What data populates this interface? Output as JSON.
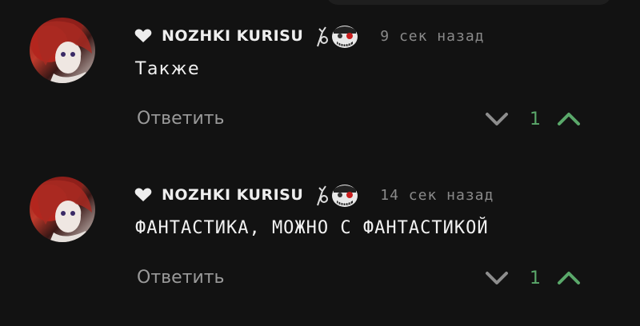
{
  "colors": {
    "background": "#121212",
    "username": "#eeeeee",
    "timestamp": "#8a8a8a",
    "text": "#f2f2f2",
    "reply": "#9a9a9a",
    "vote_down": "#8d8d8d",
    "vote_count": "#5aa86a",
    "vote_up": "#5aa86a"
  },
  "comments": [
    {
      "author": "NOZHKI KURISU",
      "timestamp": "9 сек назад",
      "text": "Также",
      "reply_label": "Ответить",
      "votes": "1",
      "icons": [
        "heart-icon",
        "tokyo-ghoul-badge-icon",
        "vote-down-chevron-icon",
        "vote-up-chevron-icon"
      ]
    },
    {
      "author": "NOZHKI KURISU",
      "timestamp": "14 сек назад",
      "text": "ФАНТАСТИКА, МОЖНО С ФАНТАСТИКОЙ",
      "reply_label": "Ответить",
      "votes": "1",
      "icons": [
        "heart-icon",
        "tokyo-ghoul-badge-icon",
        "vote-down-chevron-icon",
        "vote-up-chevron-icon"
      ]
    }
  ]
}
